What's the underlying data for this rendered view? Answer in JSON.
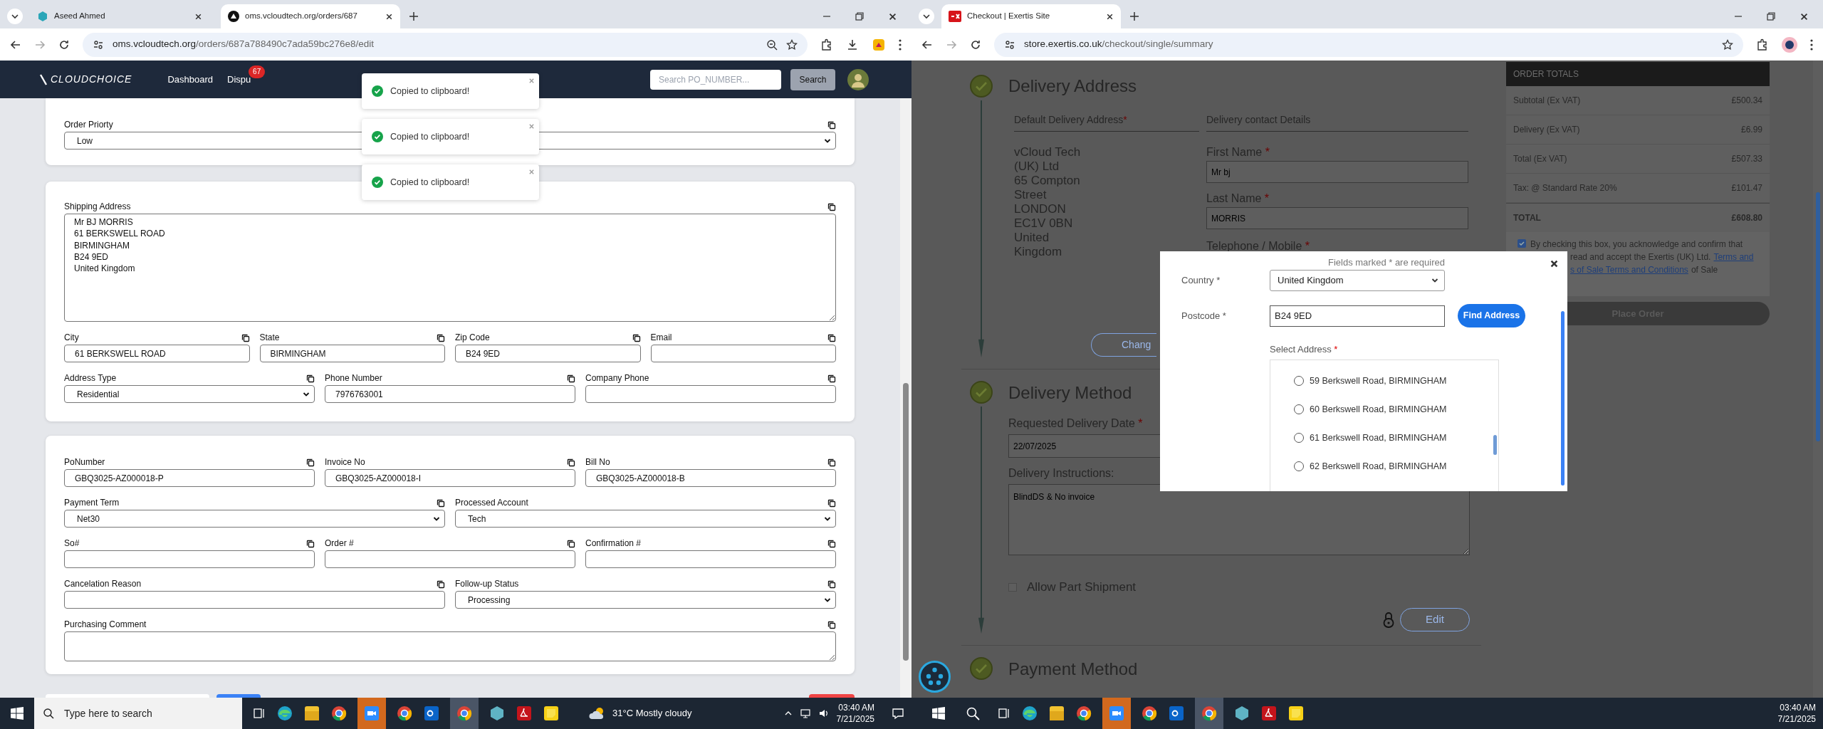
{
  "left_window": {
    "tabs": [
      {
        "title": "Aseed Ahmed",
        "kind": "hexagon",
        "selected": false
      },
      {
        "title": "oms.vcloudtech.org/orders/687",
        "kind": "triangle",
        "selected": true
      }
    ],
    "address_bar": {
      "host": "oms.vcloudtech.org",
      "path": "/orders/687a788490c7ada59bc276e8/edit"
    },
    "navbar": {
      "logo": "CLOUDCHOICE",
      "links": [
        {
          "label": "Dashboard"
        },
        {
          "label": "Dispu",
          "badge": "67"
        }
      ],
      "search": {
        "placeholder": "Search PO_NUMBER..."
      },
      "search_button": "Search"
    },
    "toasts": [
      {
        "message": "Copied to clipboard!"
      },
      {
        "message": "Copied to clipboard!"
      },
      {
        "message": "Copied to clipboard!"
      }
    ],
    "cards": [
      {
        "rows": [
          [
            {
              "kind": "select",
              "label": "Order Priorty",
              "value": "Low"
            }
          ]
        ]
      },
      {
        "rows": [
          [
            {
              "kind": "textarea_tall",
              "label": "Shipping Address",
              "value": "Mr BJ MORRIS\n61 BERKSWELL ROAD\nBIRMINGHAM\nB24 9ED\nUnited Kingdom"
            }
          ],
          [
            {
              "kind": "input",
              "label": "City",
              "value": "61 BERKSWELL ROAD"
            },
            {
              "kind": "input",
              "label": "State",
              "value": "BIRMINGHAM"
            },
            {
              "kind": "input",
              "label": "Zip Code",
              "value": "B24 9ED"
            },
            {
              "kind": "input",
              "label": "Email"
            }
          ],
          [
            {
              "kind": "select",
              "label": "Address Type",
              "value": "Residential"
            },
            {
              "kind": "input",
              "label": "Phone Number",
              "value": "7976763001"
            },
            {
              "kind": "input",
              "label": "Company Phone"
            }
          ]
        ]
      },
      {
        "rows": [
          [
            {
              "kind": "input",
              "label": "PoNumber",
              "value": "GBQ3025-AZ000018-P"
            },
            {
              "kind": "input",
              "label": "Invoice No",
              "value": "GBQ3025-AZ000018-I"
            },
            {
              "kind": "input",
              "label": "Bill No",
              "value": "GBQ3025-AZ000018-B"
            }
          ],
          [
            {
              "kind": "select",
              "label": "Payment Term",
              "value": "Net30"
            },
            {
              "kind": "select",
              "label": "Processed Account",
              "value": "Tech"
            }
          ],
          [
            {
              "kind": "input",
              "label": "So#"
            },
            {
              "kind": "input",
              "label": "Order #"
            },
            {
              "kind": "input",
              "label": "Confirmation #"
            }
          ],
          [
            {
              "kind": "input",
              "label": "Cancelation Reason"
            },
            {
              "kind": "select",
              "label": "Follow-up Status",
              "value": "Processing"
            }
          ],
          [
            {
              "kind": "textarea",
              "label": "Purchasing Comment"
            }
          ]
        ]
      }
    ]
  },
  "right_window": {
    "tabs": [
      {
        "title": "Checkout | Exertis Site",
        "kind": "exertis",
        "selected": true
      }
    ],
    "address_bar": {
      "host": "store.exertis.co.uk",
      "path": "/checkout/single/summary"
    },
    "delivery_address": {
      "title": "Delivery Address",
      "default_address": {
        "heading": "Default Delivery Address",
        "required": "*",
        "lines": [
          "vCloud Tech",
          "(UK) Ltd",
          "65 Compton",
          "Street",
          "LONDON",
          "EC1V 0BN",
          "United",
          "Kingdom"
        ]
      },
      "contact": {
        "heading": "Delivery contact Details",
        "fields": [
          {
            "label": "First Name",
            "required": "*",
            "value": "Mr bj"
          },
          {
            "label": "Last Name",
            "required": "*",
            "value": "MORRIS"
          },
          {
            "label": "Telephone / Mobile",
            "required": "*"
          }
        ]
      },
      "change_button": "Chang"
    },
    "delivery_method": {
      "title": "Delivery Method",
      "date": {
        "label": "Requested Delivery Date",
        "required": "*",
        "value": "22/07/2025"
      },
      "instructions": {
        "label": "Delivery Instructions:",
        "value": "BlindDS & No invoice"
      },
      "part_shipment": {
        "label": "Allow Part Shipment",
        "checked": false
      },
      "edit_button": "Edit"
    },
    "payment_method": {
      "title": "Payment Method"
    },
    "order_totals": {
      "title": "ORDER TOTALS",
      "rows": [
        {
          "label": "Subtotal (Ex VAT)",
          "value": "£500.34"
        },
        {
          "label": "Delivery (Ex VAT)",
          "value": "£6.99"
        },
        {
          "label": "Total (Ex VAT)",
          "value": "£507.33"
        },
        {
          "label": "Tax: @ Standard Rate 20%",
          "value": "£101.47"
        }
      ],
      "total": {
        "label": "TOTAL",
        "value": "£608.80"
      }
    },
    "terms": {
      "checked": true,
      "lines": [
        [
          {
            "kind": "text",
            "text": "By checking this box, you acknowledge and confirm that"
          }
        ],
        [
          {
            "kind": "text",
            "text": "read and accept the Exertis (UK) Ltd."
          },
          {
            "kind": "link",
            "text": "Terms and"
          }
        ],
        [
          {
            "kind": "link",
            "text": "s of Sale Terms and Conditions"
          },
          {
            "kind": "text",
            "text": "of Sale"
          }
        ]
      ]
    },
    "place_order": "Place Order",
    "modal": {
      "note": "Fields marked * are required",
      "country": {
        "label": "Country *",
        "value": "United Kingdom"
      },
      "postcode": {
        "label": "Postcode *",
        "value": "B24 9ED"
      },
      "find_button": "Find Address",
      "select_address": {
        "label": "Select Address",
        "required": "*",
        "options": [
          {
            "label": "59 Berkswell Road, BIRMINGHAM",
            "selected": false
          },
          {
            "label": "60 Berkswell Road, BIRMINGHAM",
            "selected": false
          },
          {
            "label": "61 Berkswell Road, BIRMINGHAM",
            "selected": false
          },
          {
            "label": "62 Berkswell Road, BIRMINGHAM",
            "selected": false
          }
        ]
      }
    }
  },
  "taskbars": {
    "left": {
      "search_placeholder": "Type here to search",
      "weather": "31°C Mostly cloudy",
      "time": "03:40 AM",
      "date": "7/21/2025"
    },
    "right": {
      "time": "03:40 AM",
      "date": "7/21/2025"
    }
  }
}
